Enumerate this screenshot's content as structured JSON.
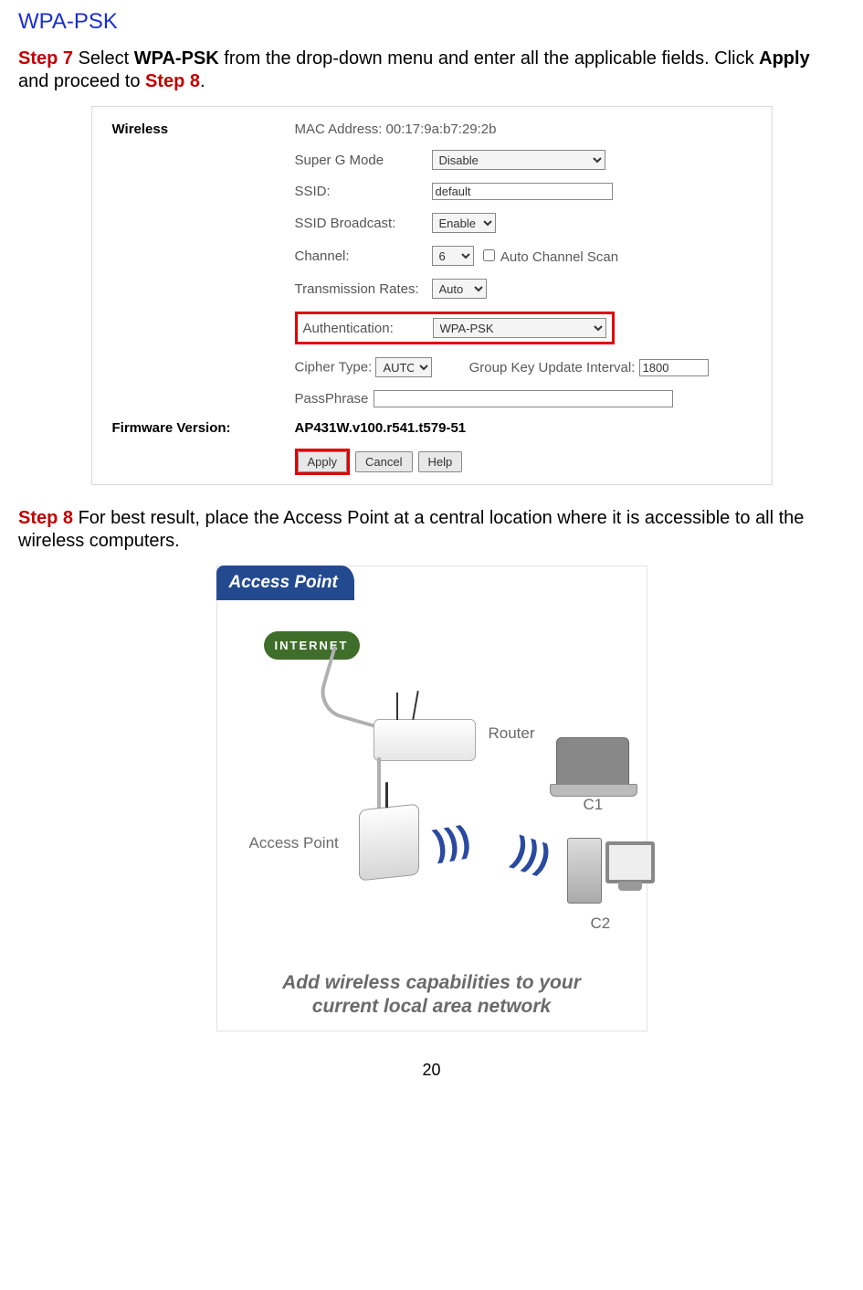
{
  "heading": "WPA-PSK",
  "step7": {
    "label": "Step 7",
    "text_a": " Select ",
    "bold1": "WPA-PSK",
    "text_b": " from the drop-down menu and enter all the applicable fields. Click ",
    "bold2": "Apply",
    "text_c": " and proceed to ",
    "step8_inline": "Step 8",
    "text_d": "."
  },
  "screenshot": {
    "sidebar": {
      "wireless": "Wireless",
      "firmware": "Firmware Version:"
    },
    "mac_label": "MAC Address: 00:17:9a:b7:29:2b",
    "superg_label": "Super G Mode",
    "superg_value": "Disable",
    "ssid_label": "SSID:",
    "ssid_value": "default",
    "ssidbc_label": "SSID Broadcast:",
    "ssidbc_value": "Enable",
    "channel_label": "Channel:",
    "channel_value": "6",
    "autoscan_label": " Auto Channel Scan",
    "txrate_label": "Transmission Rates:",
    "txrate_value": "Auto",
    "auth_label": "Authentication:",
    "auth_value": "WPA-PSK",
    "cipher_label": "Cipher Type:",
    "cipher_value": "AUTO",
    "gkui_label": "Group Key Update Interval:",
    "gkui_value": "1800",
    "pass_label": "PassPhrase",
    "pass_value": "",
    "fw_value": "AP431W.v100.r541.t579-51",
    "buttons": {
      "apply": "Apply",
      "cancel": "Cancel",
      "help": "Help"
    }
  },
  "step8": {
    "label": "Step 8",
    "text": " For best result, place the Access Point at a central location where it is accessible to all the wireless computers."
  },
  "figure2": {
    "tab": "Access Point",
    "internet": "INTERNET",
    "router": "Router",
    "ap": "Access Point",
    "c1": "C1",
    "c2": "C2",
    "caption_l1": "Add wireless capabilities to your",
    "caption_l2": "current local area network"
  },
  "page_number": "20"
}
